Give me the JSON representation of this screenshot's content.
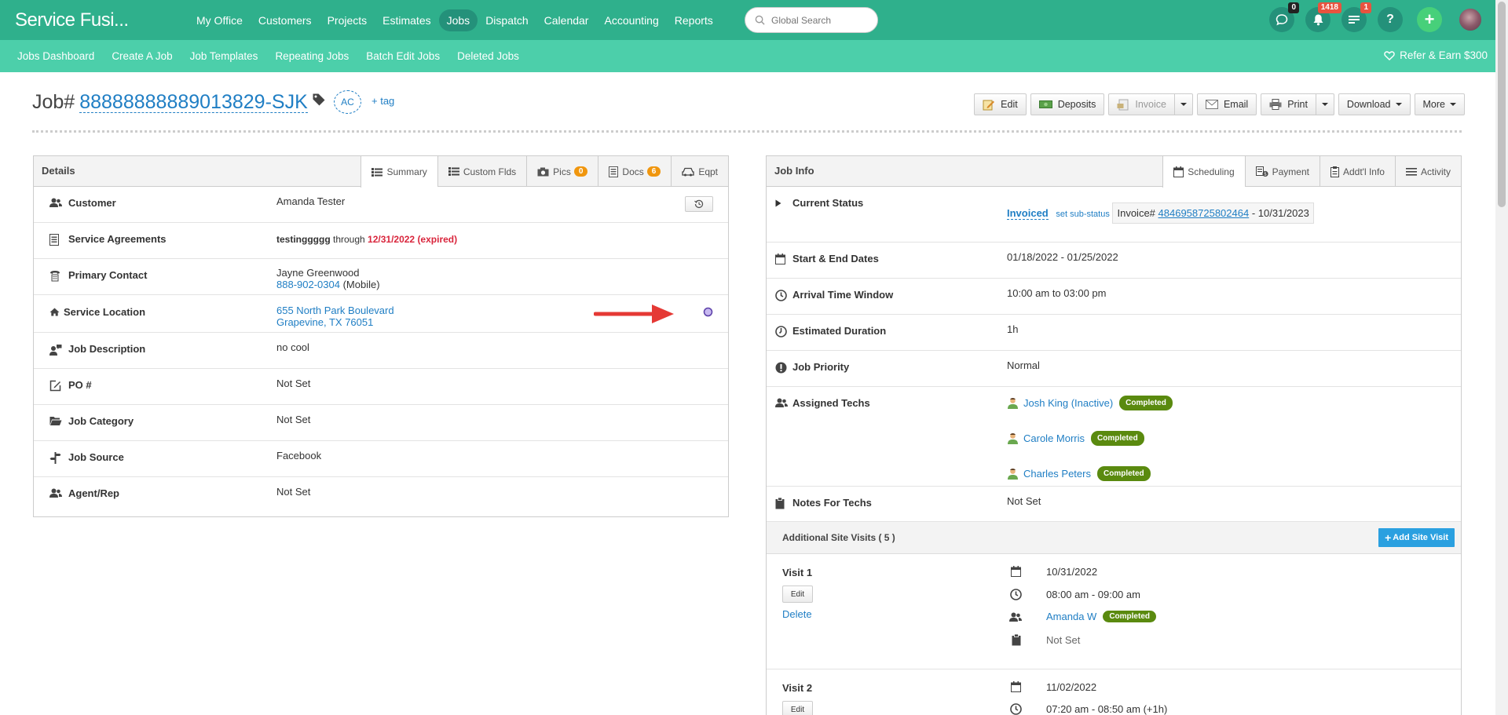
{
  "app": {
    "brand": "Service Fusi..."
  },
  "nav": {
    "items": [
      "My Office",
      "Customers",
      "Projects",
      "Estimates",
      "Jobs",
      "Dispatch",
      "Calendar",
      "Accounting",
      "Reports"
    ],
    "active": "Jobs"
  },
  "search": {
    "placeholder": "Global Search"
  },
  "top_icons": {
    "chat_count": "0",
    "notif_count": "1418",
    "tasks_count": "1",
    "help": "?",
    "add": "+"
  },
  "subnav": {
    "items": [
      "Jobs Dashboard",
      "Create A Job",
      "Job Templates",
      "Repeating Jobs",
      "Batch Edit Jobs",
      "Deleted Jobs"
    ],
    "refer": "Refer & Earn $300"
  },
  "job": {
    "prefix": "Job#",
    "number": "88888888889013829-SJK",
    "initials": "AC",
    "add_tag": "+ tag"
  },
  "actions": {
    "edit": "Edit",
    "deposits": "Deposits",
    "invoice": "Invoice",
    "email": "Email",
    "print": "Print",
    "download": "Download",
    "more": "More"
  },
  "details": {
    "title": "Details",
    "tabs": [
      {
        "label": "Summary"
      },
      {
        "label": "Custom Flds"
      },
      {
        "label": "Pics",
        "count": "0"
      },
      {
        "label": "Docs",
        "count": "6"
      },
      {
        "label": "Eqpt"
      }
    ],
    "rows": {
      "customer": {
        "label": "Customer",
        "value": "Amanda Tester"
      },
      "agreements": {
        "label": "Service Agreements",
        "name": "testinggggg",
        "through": "through",
        "date": "12/31/2022 (expired)"
      },
      "contact": {
        "label": "Primary Contact",
        "name": "Jayne Greenwood",
        "phone": "888-902-0304",
        "phone_type": "(Mobile)"
      },
      "location": {
        "label": "Service Location",
        "line1": "655 North Park Boulevard",
        "line2": "Grapevine, TX 76051"
      },
      "description": {
        "label": "Job Description",
        "value": "no cool"
      },
      "po": {
        "label": "PO #",
        "value": "Not Set"
      },
      "category": {
        "label": "Job Category",
        "value": "Not Set"
      },
      "source": {
        "label": "Job Source",
        "value": "Facebook"
      },
      "agent": {
        "label": "Agent/Rep",
        "value": "Not Set"
      }
    }
  },
  "jobinfo": {
    "title": "Job Info",
    "tabs": [
      "Scheduling",
      "Payment",
      "Addt'l Info",
      "Activity"
    ],
    "status": {
      "label": "Current Status",
      "value": "Invoiced",
      "sub": "set sub-status",
      "invoice_label": "Invoice#",
      "invoice_num": "4846958725802464",
      "invoice_date": "- 10/31/2023"
    },
    "dates": {
      "label": "Start & End Dates",
      "value": "01/18/2022 - 01/25/2022"
    },
    "arrival": {
      "label": "Arrival Time Window",
      "value": "10:00 am to 03:00 pm"
    },
    "duration": {
      "label": "Estimated Duration",
      "value": "1h"
    },
    "priority": {
      "label": "Job Priority",
      "value": "Normal"
    },
    "techs": {
      "label": "Assigned Techs",
      "list": [
        {
          "name": "Josh King (Inactive)",
          "status": "Completed"
        },
        {
          "name": "Carole Morris",
          "status": "Completed"
        },
        {
          "name": "Charles Peters",
          "status": "Completed"
        }
      ]
    },
    "notes": {
      "label": "Notes For Techs",
      "value": "Not Set"
    },
    "visits": {
      "title": "Additional Site Visits ( 5 )",
      "add": "Add Site Visit",
      "list": [
        {
          "label": "Visit 1",
          "edit": "Edit",
          "delete": "Delete",
          "date": "10/31/2022",
          "time": "08:00 am - 09:00 am",
          "tech": "Amanda W",
          "status": "Completed",
          "notes": "Not Set"
        },
        {
          "label": "Visit 2",
          "edit": "Edit",
          "date": "11/02/2022",
          "time": "07:20 am - 08:50 am (+1h)"
        }
      ]
    }
  },
  "colors": {
    "primary": "#2fb08c",
    "subnav": "#4ccfaa",
    "link": "#1f7ec4",
    "completed": "#5a8a0f",
    "badge": "#f0960e"
  }
}
